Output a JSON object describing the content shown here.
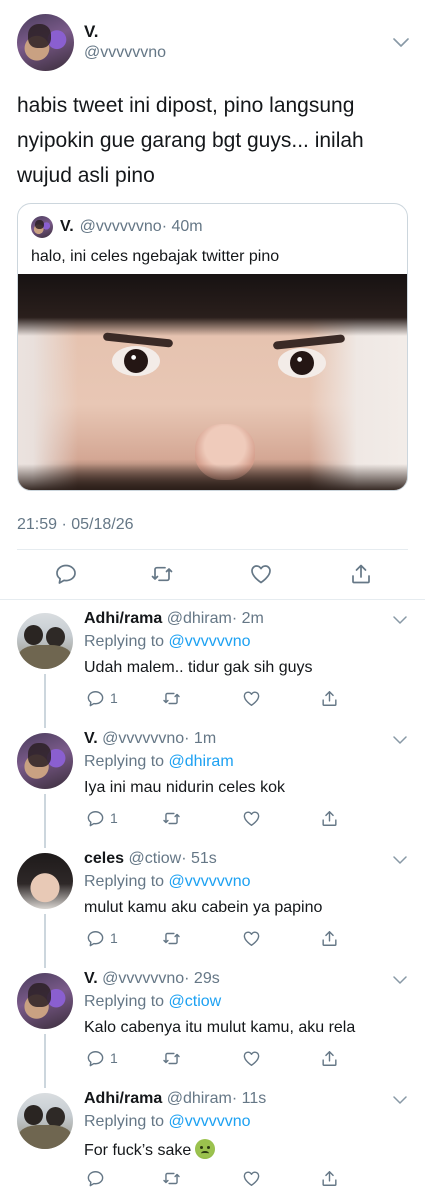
{
  "main_tweet": {
    "author_name": "V.",
    "author_handle": "@vvvvvvno",
    "text": "habis tweet ini dipost, pino langsung nyipokin gue garang bgt guys... inilah wujud asli pino",
    "timestamp": "21:59 · 05/18/26",
    "quote": {
      "author_name": "V.",
      "author_handle": "@vvvvvvno",
      "time": "· 40m",
      "text": "halo, ini celes ngebajak twitter pino"
    },
    "actions": [
      "reply-icon",
      "retweet-icon",
      "like-icon",
      "share-icon"
    ]
  },
  "replies": [
    {
      "name": "Adhi/rama",
      "handle": "@dhiram",
      "time": "· 2m",
      "replying_prefix": "Replying to",
      "replying_to": "@vvvvvvno",
      "text": "Udah malem.. tidur gak sih guys",
      "reply_count": "1"
    },
    {
      "name": "V.",
      "handle": "@vvvvvvno",
      "time": "· 1m",
      "replying_prefix": "Replying to",
      "replying_to": "@dhiram",
      "text": "Iya ini mau nidurin celes kok",
      "reply_count": "1"
    },
    {
      "name": "celes",
      "handle": "@ctiow",
      "time": "· 51s",
      "replying_prefix": "Replying to",
      "replying_to": "@vvvvvvno",
      "text": "mulut kamu aku cabein ya papino",
      "reply_count": "1"
    },
    {
      "name": "V.",
      "handle": "@vvvvvvno",
      "time": "· 29s",
      "replying_prefix": "Replying to",
      "replying_to": "@ctiow",
      "text": "Kalo cabenya itu mulut kamu, aku rela",
      "reply_count": "1"
    },
    {
      "name": "Adhi/rama",
      "handle": "@dhiram",
      "time": "· 11s",
      "replying_prefix": "Replying to",
      "replying_to": "@vvvvvvno",
      "text": "For fuck’s sake",
      "reply_count": "",
      "emoji": "nauseated-face-icon"
    }
  ],
  "colors": {
    "link": "#1da1f2",
    "secondary_text": "#657786",
    "primary_text": "#14171a",
    "border": "#e6ecf0"
  }
}
